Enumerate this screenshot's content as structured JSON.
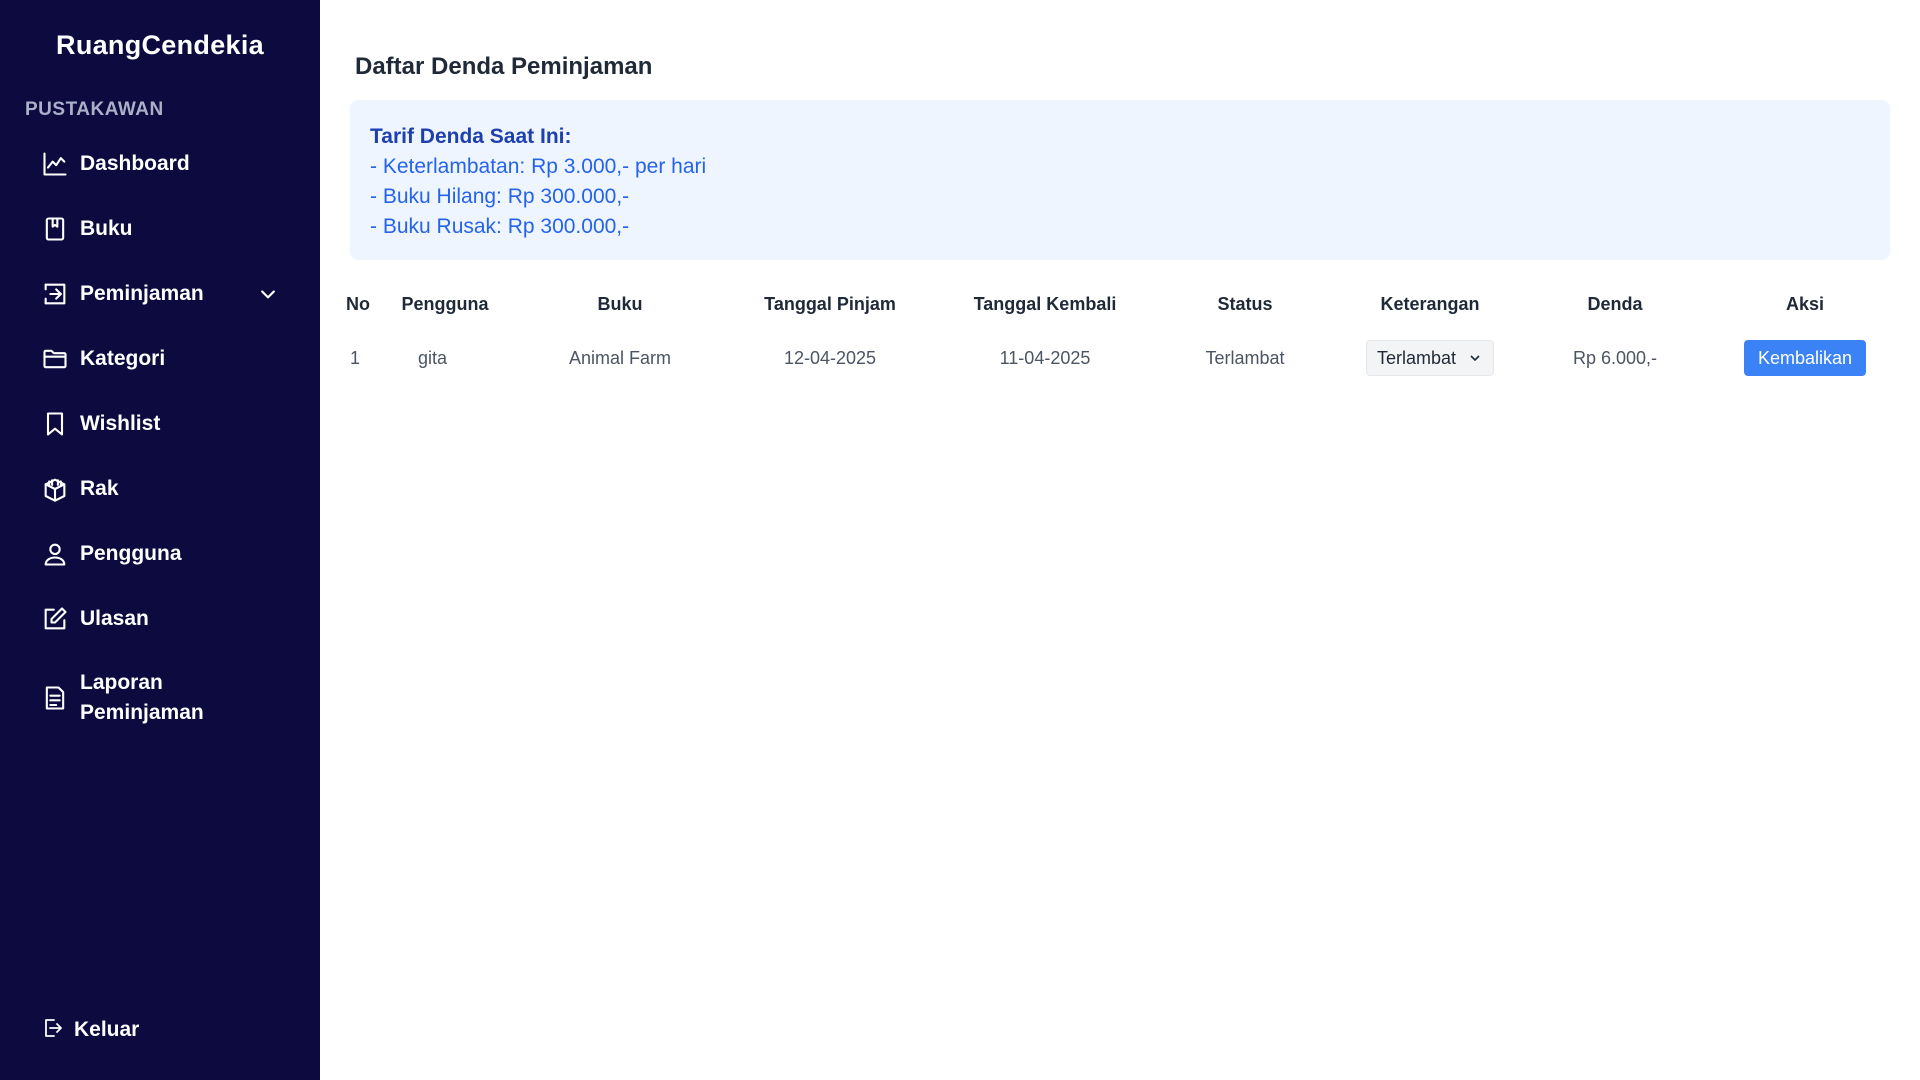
{
  "sidebar": {
    "brand": "RuangCendekia",
    "section_label": "PUSTAKAWAN",
    "items": [
      {
        "label": "Dashboard",
        "icon": "chart-line-icon"
      },
      {
        "label": "Buku",
        "icon": "book-icon"
      },
      {
        "label": "Peminjaman",
        "icon": "login-arrow-icon",
        "has_dropdown": true
      },
      {
        "label": "Kategori",
        "icon": "folder-icon"
      },
      {
        "label": "Wishlist",
        "icon": "bookmark-icon"
      },
      {
        "label": "Rak",
        "icon": "shelf-icon"
      },
      {
        "label": "Pengguna",
        "icon": "user-icon"
      },
      {
        "label": "Ulasan",
        "icon": "edit-icon"
      },
      {
        "label": "Laporan Peminjaman",
        "icon": "document-icon"
      }
    ],
    "logout_label": "Keluar"
  },
  "main": {
    "title": "Daftar Denda Peminjaman",
    "info": {
      "title": "Tarif Denda Saat Ini:",
      "lines": [
        "- Keterlambatan: Rp 3.000,- per hari",
        "- Buku Hilang: Rp 300.000,-",
        "- Buku Rusak: Rp 300.000,-"
      ]
    },
    "table": {
      "headers": [
        "No",
        "Pengguna",
        "Buku",
        "Tanggal Pinjam",
        "Tanggal Kembali",
        "Status",
        "Keterangan",
        "Denda",
        "Aksi"
      ],
      "rows": [
        {
          "no": "1",
          "pengguna": "gita",
          "buku": "Animal Farm",
          "tanggal_pinjam": "12-04-2025",
          "tanggal_kembali": "11-04-2025",
          "status": "Terlambat",
          "keterangan": "Terlambat",
          "denda": "Rp 6.000,-",
          "aksi": "Kembalikan"
        }
      ]
    }
  },
  "colors": {
    "sidebar_bg": "#0c0a3e",
    "info_bg": "#eef5ff",
    "info_text": "#2563eb",
    "primary_button": "#3b82f6"
  }
}
